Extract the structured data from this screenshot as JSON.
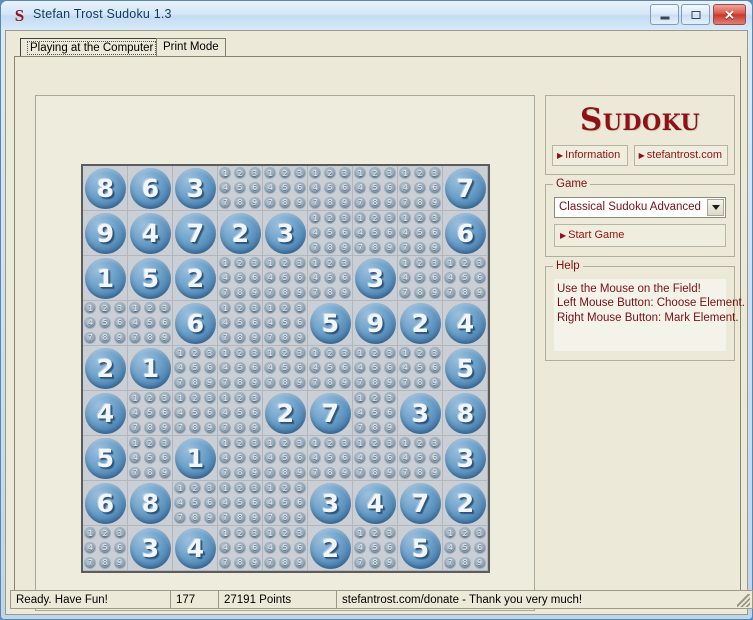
{
  "window": {
    "title": "Stefan Trost Sudoku 1.3",
    "app_icon": "sudoku-s-icon",
    "minimize_label": "Minimize",
    "maximize_label": "Maximize",
    "close_label": "✕"
  },
  "tabs": [
    {
      "label": "Playing at the Computer",
      "selected": true
    },
    {
      "label": "Print Mode",
      "selected": false
    }
  ],
  "logo": {
    "text": "Sudoku",
    "buttons": [
      {
        "label": "Information"
      },
      {
        "label": "stefantrost.com"
      }
    ]
  },
  "game": {
    "legend": "Game",
    "selected_mode": "Classical Sudoku Advanced",
    "options": [
      "Classical Sudoku Advanced"
    ],
    "start_label": "Start Game"
  },
  "help": {
    "legend": "Help",
    "lines": [
      "Use the Mouse on the Field!",
      "Left Mouse Button: Choose Element.",
      "Right Mouse Button: Mark Element."
    ]
  },
  "statusbar": {
    "status": "Ready. Have Fun!",
    "count": "177",
    "points": "27191 Points",
    "donate": "stefantrost.com/donate - Thank you very much!"
  },
  "colors": {
    "accent_red": "#8e1117",
    "title_blue": "#133a5e",
    "panel_beige": "#ece9d8",
    "stone_blue": "#4d84b4",
    "board_bg": "#c9cfd4"
  },
  "board": {
    "size": 9,
    "candidates": [
      1,
      2,
      3,
      4,
      5,
      6,
      7,
      8,
      9
    ],
    "grid": [
      [
        8,
        6,
        3,
        0,
        0,
        0,
        0,
        0,
        7
      ],
      [
        9,
        4,
        7,
        2,
        3,
        0,
        0,
        0,
        6
      ],
      [
        1,
        5,
        2,
        0,
        0,
        0,
        3,
        0,
        0
      ],
      [
        0,
        0,
        6,
        0,
        0,
        5,
        9,
        2,
        4
      ],
      [
        2,
        1,
        0,
        0,
        0,
        0,
        0,
        0,
        5
      ],
      [
        4,
        0,
        0,
        0,
        2,
        7,
        0,
        3,
        8
      ],
      [
        5,
        0,
        1,
        0,
        0,
        0,
        0,
        0,
        3
      ],
      [
        6,
        8,
        0,
        0,
        0,
        3,
        4,
        7,
        2
      ],
      [
        0,
        3,
        4,
        0,
        0,
        2,
        0,
        5,
        0
      ]
    ]
  }
}
